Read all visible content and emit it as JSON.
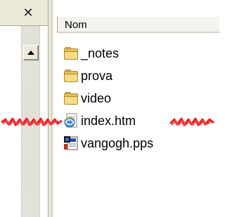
{
  "left_pane": {
    "close_glyph": "✕"
  },
  "file_list": {
    "column_header": "Nom",
    "items": [
      {
        "name": "_notes",
        "icon": "folder-icon"
      },
      {
        "name": "prova",
        "icon": "folder-icon"
      },
      {
        "name": "video",
        "icon": "folder-icon"
      },
      {
        "name": "index.htm",
        "icon": "html-document-icon"
      },
      {
        "name": "vangogh.pps",
        "icon": "powerpoint-show-icon"
      }
    ]
  },
  "colors": {
    "panel_bg": "#ece9d8",
    "folder": "#f8dc86",
    "scribble": "#e8202a"
  }
}
